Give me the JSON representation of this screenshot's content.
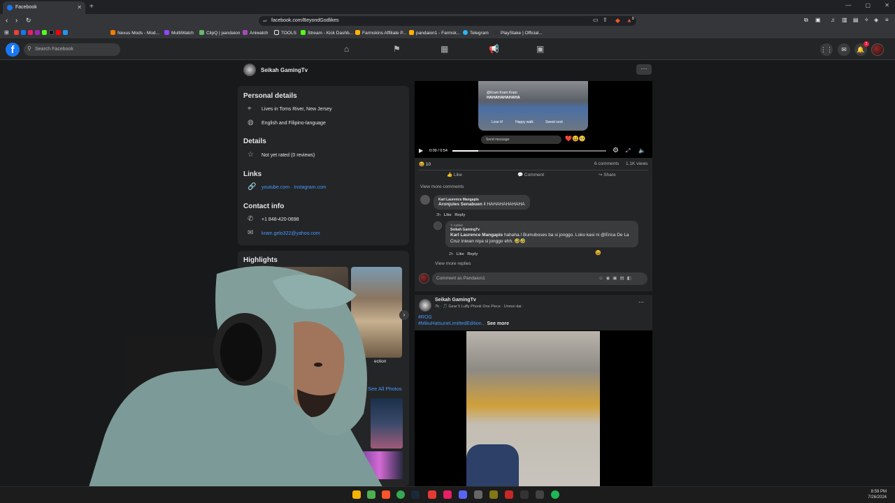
{
  "browser": {
    "tab_title": "Facebook",
    "url": "facebook.com/BeyondGodlikes",
    "bookmarks": [
      "Nexus Mods - Mod...",
      "MultiWatch",
      "ClipQ | pandaion",
      "Aniwatch",
      "TOOLS",
      "Stream - Kick Dashb...",
      "Farmskins Affiliate P...",
      "pandaion1 - Farmsk...",
      "Telegram",
      "PlayStake | Official..."
    ],
    "ext_badge": "9"
  },
  "fb": {
    "search_placeholder": "Search Facebook",
    "notif_count": "1"
  },
  "profile": {
    "name": "Seikah GamingTv",
    "more": "···"
  },
  "about": {
    "personal_title": "Personal details",
    "lives": "Lives in Toms River, New Jersey",
    "language": "English and Filipino-language",
    "details_title": "Details",
    "rating": "Not yet rated (0 reviews)",
    "links_title": "Links",
    "links": "youtube.com · Instagram.com",
    "contact_title": "Contact info",
    "phone": "+1 848-420-0698",
    "email": "kram.gelo322@yahoo.com",
    "highlights_title": "Highlights",
    "highlight_caption": "ection",
    "see_all": "See All Photos"
  },
  "video_post": {
    "overlay_name": "@Kram Kram Kram",
    "overlay_text": "HAHAHAHAHAHA",
    "chip1": "Love it!",
    "chip2": "Happy walk",
    "chip3": "Sweet soot",
    "send_message": "Send message",
    "time": "0:09 / 0:54",
    "progress": 0.17,
    "reactions": "10",
    "comments_count": "6 comments",
    "views": "1.1K views",
    "like": "Like",
    "comment": "Comment",
    "share": "Share",
    "view_more_comments": "View more comments",
    "c1_author": "Karl Laurence Mangapis",
    "c1_mention": "Aronjules Senabuen",
    "c1_text": "ll HAHAHAHAHAHA",
    "c1_time": "3h",
    "reply_like": "Like",
    "reply_reply": "Reply",
    "author_badge": "Author",
    "c2_author": "Seikah GamingTv",
    "c2_mention": "Karl Laurence Mangapis",
    "c2_text": "hahaha.! Bumuboses ba si jonggo. Loko kasi ni @Erica De La Cruz iniwan niya si jonggo ehh. 🤣🤣",
    "c2_time": "2h",
    "view_more_replies": "View more replies",
    "comment_as": "Comment as Pandaion1"
  },
  "post2": {
    "author": "Seikah GamingTv",
    "meta": "7h · 🎵 Gear 5 Luffy Phonk One Piece · Unmei dai ·",
    "tag1": "#ROG",
    "tag2": "#MikuHatsuneLimittedEdition...",
    "see_more": "See more"
  },
  "taskbar": {
    "time": "8:59 PM",
    "date": "7/26/2024"
  }
}
